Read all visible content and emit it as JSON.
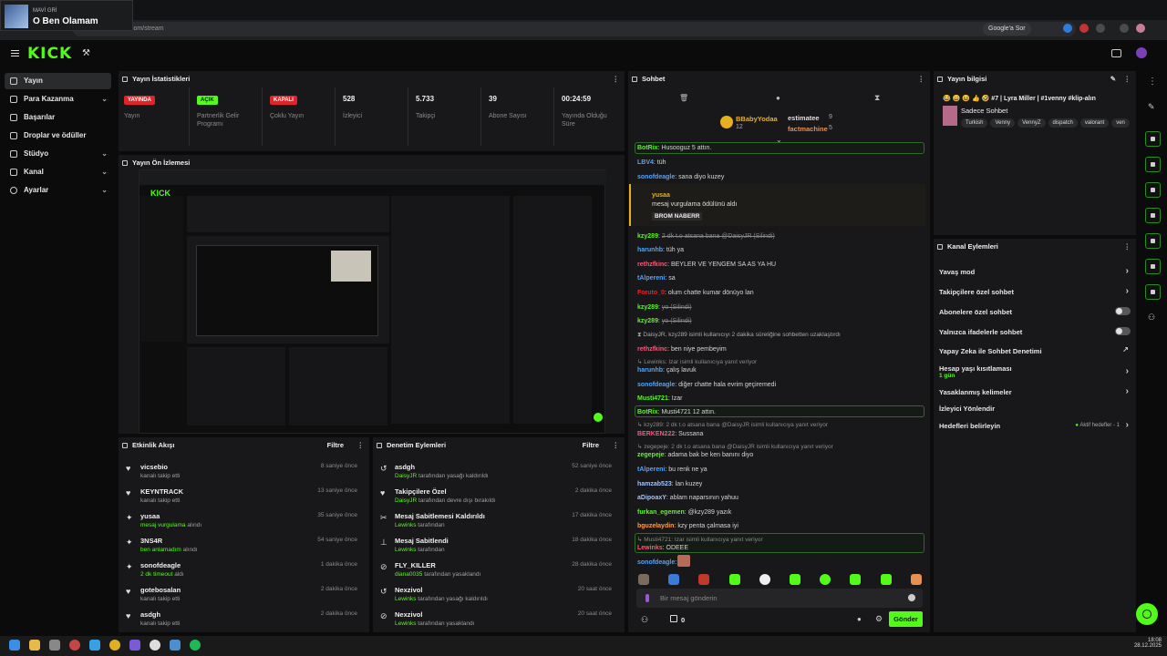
{
  "media": {
    "artist": "MAVİ GRİ",
    "title": "O Ben Olamam"
  },
  "browser": {
    "url": "dashboard.kick.com/stream",
    "google_label": "Google'a Sor"
  },
  "brand": {
    "logo": "KICK",
    "accent": "#53fc18"
  },
  "sidebar": {
    "items": [
      {
        "label": "Yayın"
      },
      {
        "label": "Para Kazanma"
      },
      {
        "label": "Başarılar"
      },
      {
        "label": "Droplar ve ödüller"
      },
      {
        "label": "Stüdyo"
      },
      {
        "label": "Kanal"
      },
      {
        "label": "Ayarlar"
      }
    ]
  },
  "stats": {
    "title": "Yayın İstatistikleri",
    "items": [
      {
        "value": "YAYINDA",
        "label": "Yayın"
      },
      {
        "value": "AÇIK",
        "label": "Partnerlik Gelir Programı"
      },
      {
        "value": "KAPALI",
        "label": "Çoklu Yayın"
      },
      {
        "value": "528",
        "label": "İzleyici"
      },
      {
        "value": "5.733",
        "label": "Takipçi"
      },
      {
        "value": "39",
        "label": "Abone Sayısı"
      },
      {
        "value": "00:24:59",
        "label": "Yayında Olduğu Süre"
      }
    ]
  },
  "preview": {
    "title": "Yayın Ön İzlemesi"
  },
  "activity": {
    "title": "Etkinlik Akışı",
    "filter": "Filtre",
    "rows": [
      {
        "name": "vicsebio",
        "sub": "kanalı takip etti",
        "time": "8 saniye önce"
      },
      {
        "name": "KEYNTRACK",
        "sub": "kanalı takip etti",
        "time": "13 saniye önce"
      },
      {
        "name": "yusaa",
        "sub_hl": "mesaj vurgulama",
        "sub": "alındı",
        "time": "35 saniye önce"
      },
      {
        "name": "3NS4R",
        "sub_hl": "ben anlamadım",
        "sub": "alındı",
        "time": "54 saniye önce"
      },
      {
        "name": "sonofdeagle",
        "sub_hl": "2 dk timeout",
        "sub": "aldı",
        "time": "1 dakika önce"
      },
      {
        "name": "gotebosalan",
        "sub": "kanalı takip etti",
        "time": "2 dakika önce"
      },
      {
        "name": "asdgh",
        "sub": "kanalı takip etti",
        "time": "2 dakika önce"
      }
    ]
  },
  "moderation": {
    "title": "Denetim Eylemleri",
    "filter": "Filtre",
    "rows": [
      {
        "name": "asdgh",
        "sub_hl": "DaisyJR",
        "sub": "tarafından yasağı kaldırıldı",
        "time": "52 saniye önce"
      },
      {
        "name": "Takipçilere Özel",
        "sub_hl": "DaisyJR",
        "sub": "tarafından devre dışı bırakıldı",
        "time": "2 dakika önce"
      },
      {
        "name": "Mesaj Sabitlemesi Kaldırıldı",
        "sub_hl": "Lewinks",
        "sub": "tarafından",
        "time": "17 dakika önce"
      },
      {
        "name": "Mesaj Sabitlendi",
        "sub_hl": "Lewinks",
        "sub": "tarafından",
        "time": "18 dakika önce"
      },
      {
        "name": "FLY_KILLER",
        "sub_hl": "diana0035",
        "sub": "tarafından yasaklandı",
        "time": "28 dakika önce"
      },
      {
        "name": "Nexzivol",
        "sub_hl": "Lewinks",
        "sub": "tarafından yasağı kaldırıldı",
        "time": "20 saat önce"
      },
      {
        "name": "Nexzivol",
        "sub_hl": "Lewinks",
        "sub": "tarafından yasaklandı",
        "time": "20 saat önce"
      }
    ]
  },
  "chat": {
    "title": "Sohbet",
    "leader1": {
      "name": "BBabyYodaa",
      "count": "12"
    },
    "leader2": {
      "name": "estimatee",
      "count": "9"
    },
    "leader3": {
      "name": "factmachine",
      "count": "5"
    },
    "highlight": {
      "user": "yusaa",
      "text": "mesaj vurgulama ödülünü aldı",
      "reward": "BROM NABERR"
    },
    "messages": [
      {
        "user": "BotRix",
        "text": "Husooguz 5 attın.",
        "color": "#53fc18"
      },
      {
        "user": "LBV4",
        "text": "tüh",
        "color": "#4fa3ff"
      },
      {
        "user": "sonofdeagle",
        "text": "sana diyo kuzey",
        "color": "#4fa3ff"
      },
      {
        "user": "kzy289",
        "text": "2 dk t.o atsana bana @DaisyJR (Silindi)",
        "color": "#53fc18"
      },
      {
        "user": "harunhb",
        "text": "tüh ya",
        "color": "#4fa3ff"
      },
      {
        "user": "rethzfkinc",
        "text": "BEYLER VE YENGEM SA AS YA HU",
        "color": "#ff5577"
      },
      {
        "user": "tAlpereni",
        "text": "sa",
        "color": "#4fa3ff"
      },
      {
        "user": "Foruto_0",
        "text": "olum chatte kumar dönüyo lan",
        "color": "#e0242a"
      },
      {
        "user": "kzy289",
        "text": "yo (Silindi)",
        "color": "#53fc18"
      },
      {
        "user": "kzy289",
        "text": "yo (Silindi)",
        "color": "#53fc18"
      },
      {
        "user": "DaisyJR",
        "text": "kzy289 isimli kullanıcıyı 2 dakika süreliğine sohbetten uzaklaştırdı",
        "color": "#aaaaaa"
      },
      {
        "user": "rethzfkinc",
        "text": "ben niye pembeyim",
        "color": "#ff5577"
      },
      {
        "user": "Lewinks",
        "text": "Izar isimli kullanıcıya yanıt veriyor",
        "color": "#8a8a8a"
      },
      {
        "user": "harunhb",
        "text": "çalış lavuk",
        "color": "#4fa3ff"
      },
      {
        "user": "sonofdeagle",
        "text": "diğer chatte hala evrim geçiremedi",
        "color": "#4fa3ff"
      },
      {
        "user": "Musti4721",
        "text": "Izar",
        "color": "#53fc18"
      },
      {
        "user": "BotRix",
        "text": "Musti4721 12 attın.",
        "color": "#53fc18"
      },
      {
        "user": "kzy289",
        "text": "2 dk t.o atsana bana @DaisyJR isimli kullanıcıya yanıt veriyor",
        "color": "#8a8a8a"
      },
      {
        "user": "BERKEN222",
        "text": "Sussana",
        "color": "#ff5577"
      },
      {
        "user": "zegepeje",
        "text": "2 dk t.o atsana bana @DaisyJR isimli kullanıcıya yanıt veriyor",
        "color": "#8a8a8a"
      },
      {
        "user": "zegepeje",
        "text": "adama bak be ken banını diyo",
        "color": "#53fc18"
      },
      {
        "user": "tAlpereni",
        "text": "bu renk ne ya",
        "color": "#4fa3ff"
      },
      {
        "user": "hamzab523",
        "text": "lan kuzey",
        "color": "#9fc3ff"
      },
      {
        "user": "aDipoaxY",
        "text": "ablam naparsının yahuu",
        "color": "#9fc3ff"
      },
      {
        "user": "furkan_egemen",
        "text": "@kzy289 yazık",
        "color": "#53fc18"
      },
      {
        "user": "bguzelaydin",
        "text": "kzy penta çalmasa iyi",
        "color": "#ff9f43"
      },
      {
        "user": "Musti4721",
        "text": "Izar isimli kullanıcıya yanıt veriyor",
        "color": "#8a8a8a"
      },
      {
        "user": "Lewinks",
        "text": "ÖDEEE",
        "color": "#ff5577"
      },
      {
        "user": "sonofdeagle",
        "text": "",
        "color": "#4fa3ff"
      }
    ],
    "input_placeholder": "Bir mesaj gönderin",
    "points": "0",
    "send_label": "Gönder"
  },
  "stream_info": {
    "title": "Yayın bilgisi",
    "stream_title": "😂 😄 😆 👍 🤣 #7 | Lyra Miller | #1venny #klip-alın",
    "chat_mode": "Sadece Sohbet",
    "tags": [
      "Turkish",
      "Venny",
      "VennyZ",
      "dispatch",
      "valorant",
      "ven"
    ]
  },
  "channel_actions": {
    "title": "Kanal Eylemleri",
    "items": [
      {
        "label": "Yavaş mod"
      },
      {
        "label": "Takipçilere özel sohbet"
      },
      {
        "label": "Abonelere özel sohbet"
      },
      {
        "label": "Yalnızca ifadelerle sohbet"
      },
      {
        "label": "Yapay Zeka ile Sohbet Denetimi"
      },
      {
        "label": "Hesap yaşı kısıtlaması",
        "sub": "1 gün"
      },
      {
        "label": "Yasaklanmış kelimeler"
      },
      {
        "label": "İzleyici Yönlendir"
      },
      {
        "label": "Hedefleri belirleyin",
        "status": "Aktif hedefler - 1"
      }
    ]
  },
  "clock": {
    "time": "18:08",
    "date": "28.12.2025"
  }
}
